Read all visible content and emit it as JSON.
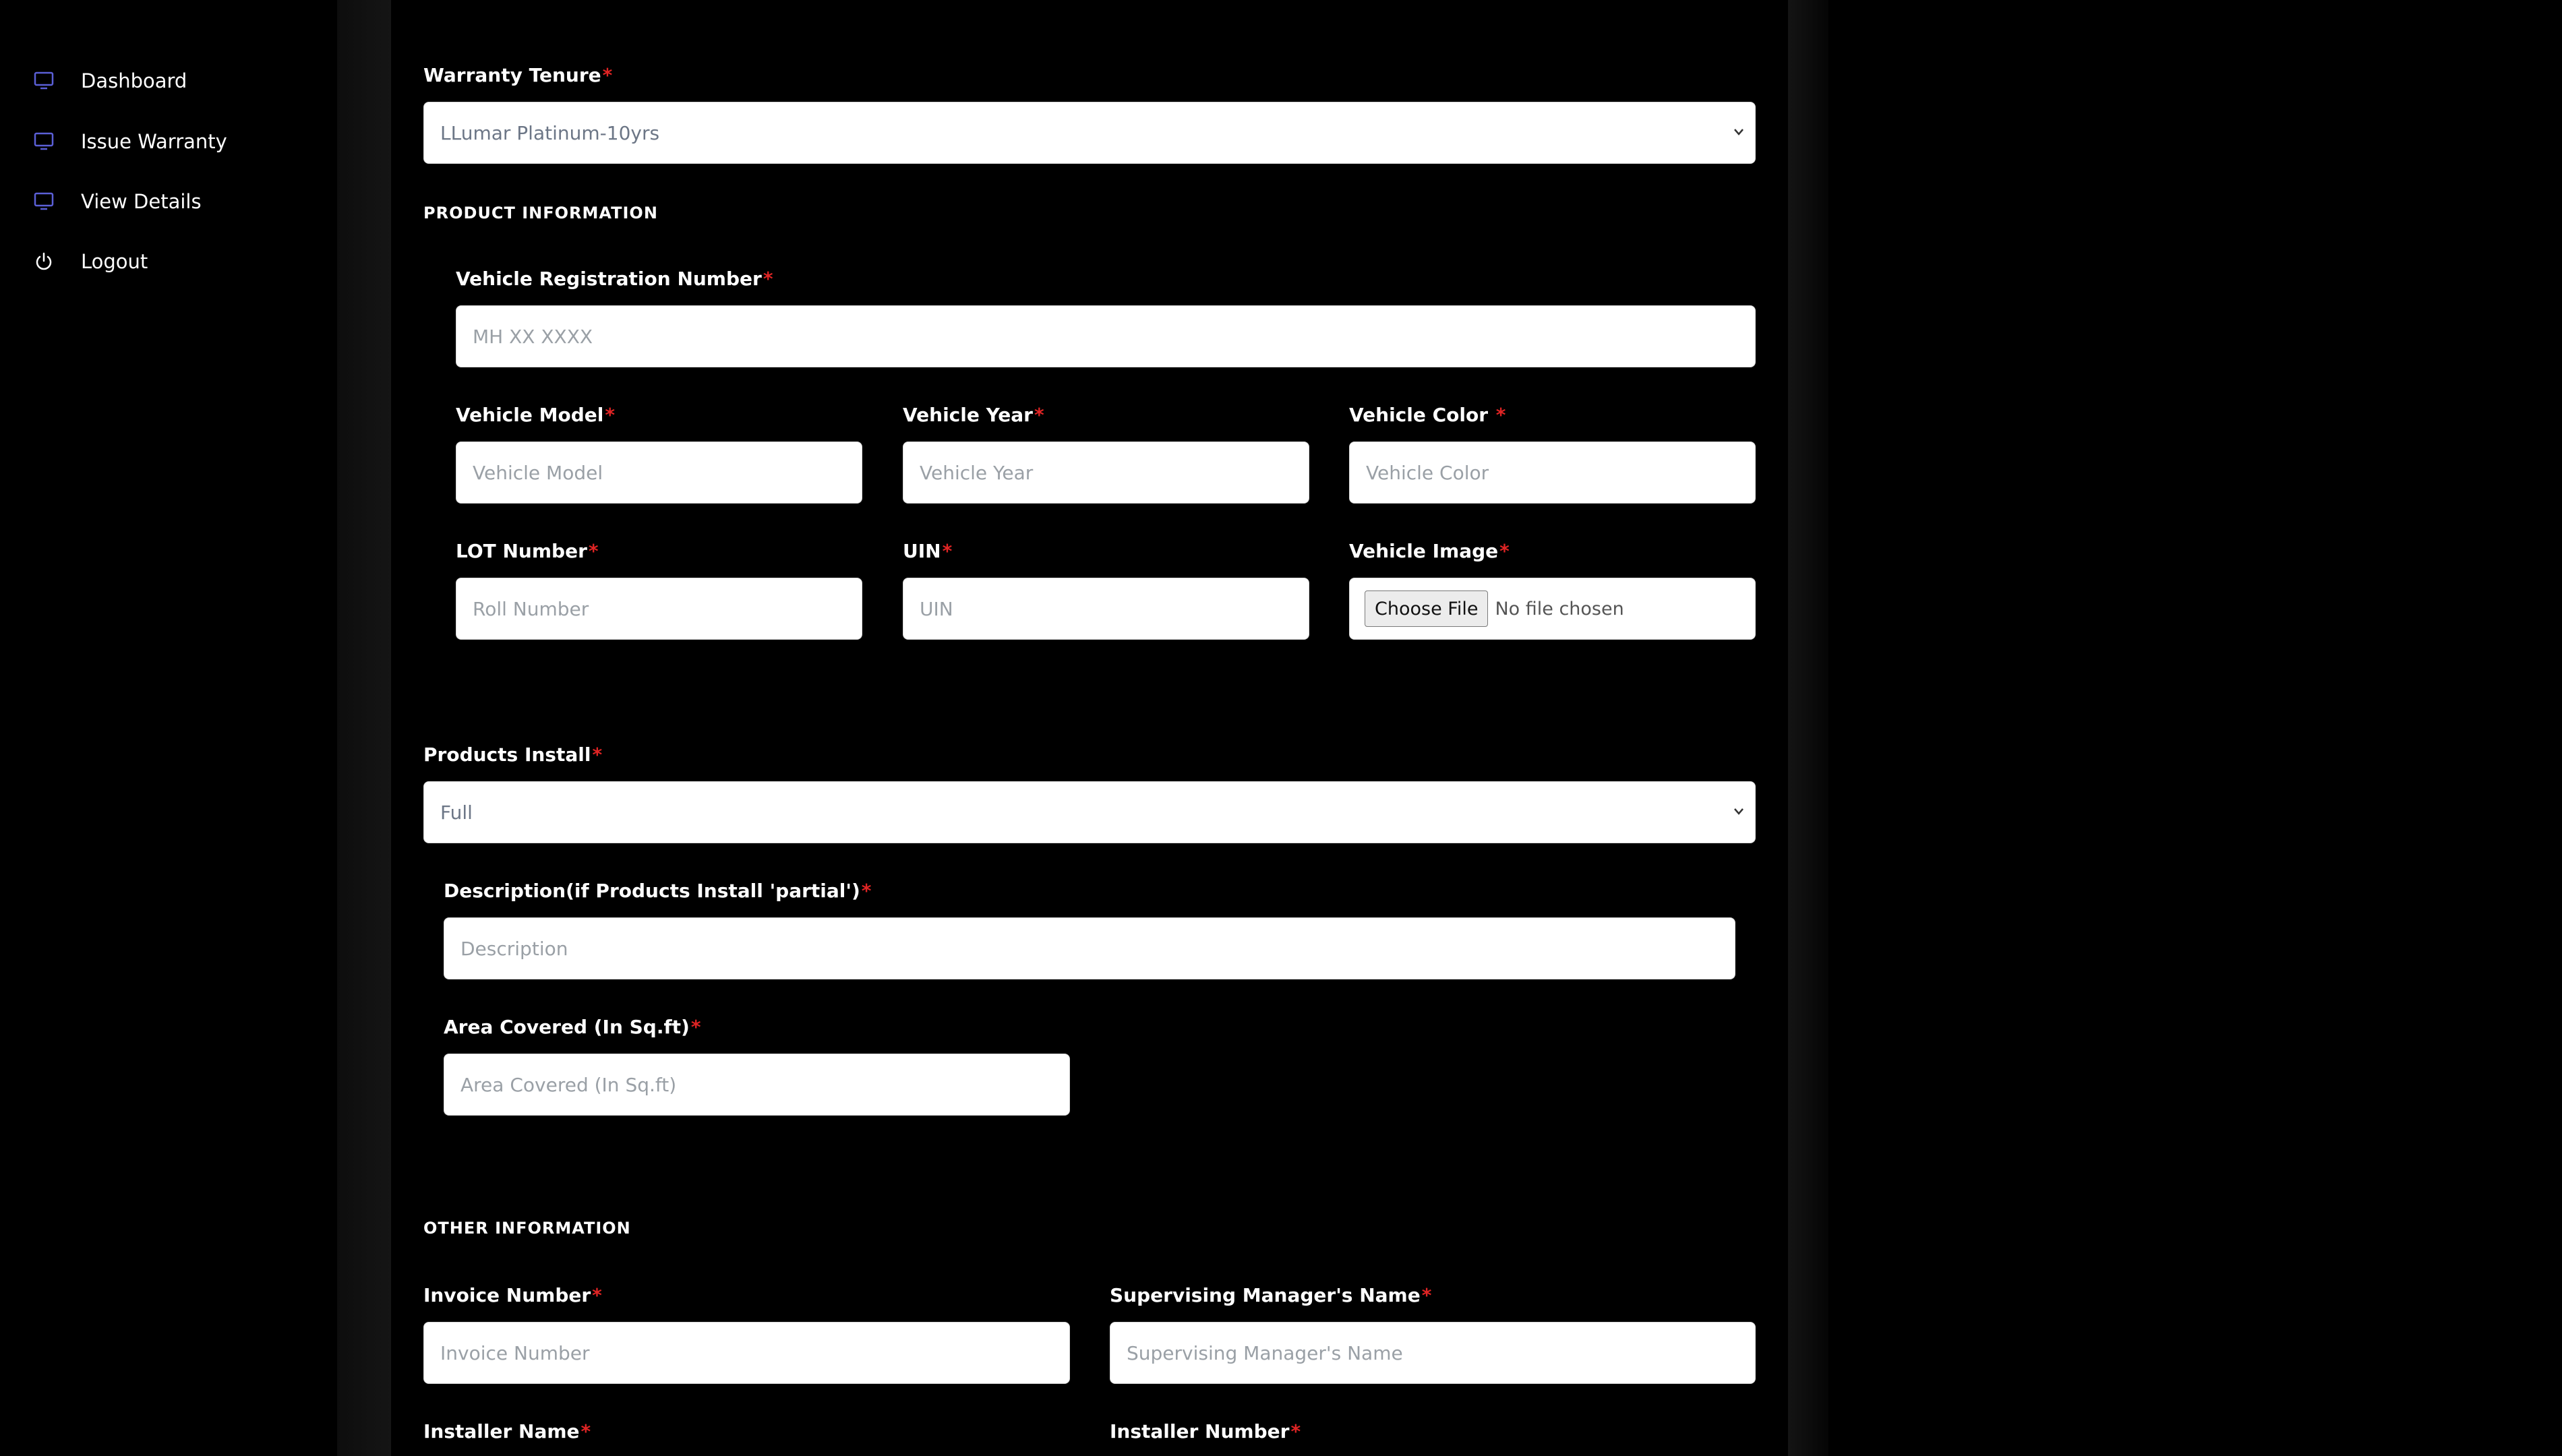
{
  "sidebar": {
    "items": [
      {
        "label": "Dashboard",
        "icon": "monitor-icon"
      },
      {
        "label": "Issue Warranty",
        "icon": "monitor-icon"
      },
      {
        "label": "View Details",
        "icon": "monitor-icon"
      },
      {
        "label": "Logout",
        "icon": "power-icon"
      }
    ]
  },
  "colors": {
    "required": "#e02424",
    "icon": "#5b5fd6",
    "background": "#000000"
  },
  "form": {
    "required_mark": "*",
    "warranty_tenure": {
      "label": "Warranty Tenure",
      "value": "LLumar Platinum-10yrs"
    },
    "product_section_title": "PRODUCT INFORMATION",
    "vehicle_registration": {
      "label": "Vehicle Registration Number",
      "placeholder": "MH XX XXXX"
    },
    "vehicle_model": {
      "label": "Vehicle Model",
      "placeholder": "Vehicle Model"
    },
    "vehicle_year": {
      "label": "Vehicle Year",
      "placeholder": "Vehicle Year"
    },
    "vehicle_color": {
      "label": "Vehicle Color ",
      "placeholder": "Vehicle Color"
    },
    "lot_number": {
      "label": "LOT Number",
      "placeholder": "Roll Number"
    },
    "uin": {
      "label": "UIN",
      "placeholder": "UIN"
    },
    "vehicle_image": {
      "label": "Vehicle Image",
      "button": "Choose File",
      "status": "No file chosen"
    },
    "products_install": {
      "label": "Products Install",
      "value": "Full"
    },
    "description": {
      "label": "Description(if Products Install 'partial')",
      "placeholder": "Description"
    },
    "area_covered": {
      "label": "Area Covered (In Sq.ft)",
      "placeholder": "Area Covered (In Sq.ft)"
    },
    "other_section_title": "OTHER INFORMATION",
    "invoice_number": {
      "label": "Invoice Number",
      "placeholder": "Invoice Number"
    },
    "supervising_manager": {
      "label": "Supervising Manager's Name",
      "placeholder": "Supervising Manager's Name"
    },
    "installer_name": {
      "label": "Installer Name"
    },
    "installer_number": {
      "label": "Installer Number"
    }
  }
}
